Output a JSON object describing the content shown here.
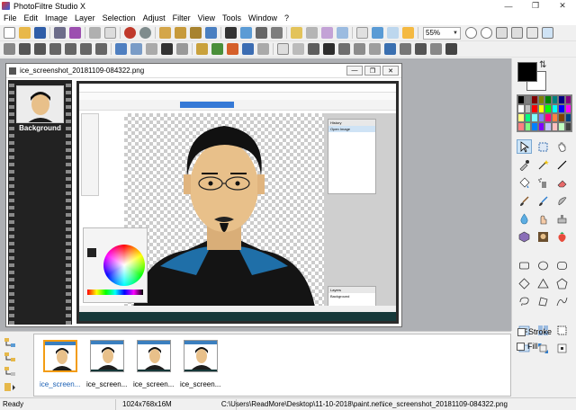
{
  "window": {
    "title": "PhotoFiltre Studio X"
  },
  "menu": [
    "File",
    "Edit",
    "Image",
    "Layer",
    "Selection",
    "Adjust",
    "Filter",
    "View",
    "Tools",
    "Window",
    "?"
  ],
  "toolbar": {
    "zoom_value": "55%"
  },
  "document": {
    "title": "ice_screenshot_20181109-084322.png",
    "layer_label": "Background",
    "inner_app": {
      "panel_layers_title": "Layers",
      "panel_history_title": "History",
      "history_item": "Open Image",
      "layer_item": "Background"
    }
  },
  "right_panel": {
    "fg_color": "#000000",
    "bg_color": "#ffffff",
    "stroke_label": "Stroke",
    "fill_label": "Fill",
    "palette": [
      "#000000",
      "#808080",
      "#800000",
      "#808000",
      "#008000",
      "#008080",
      "#000080",
      "#800080",
      "#ffffff",
      "#c0c0c0",
      "#ff0000",
      "#ffff00",
      "#00ff00",
      "#00ffff",
      "#0000ff",
      "#ff00ff",
      "#ffff80",
      "#00ff80",
      "#80ffff",
      "#8080ff",
      "#ff0080",
      "#ff8040",
      "#804000",
      "#004080",
      "#ff8080",
      "#80ff80",
      "#0080ff",
      "#8000ff",
      "#c0c0ff",
      "#ffc0c0",
      "#c0ffc0",
      "#404040"
    ]
  },
  "thumbnails": [
    {
      "label": "ice_screen...",
      "selected": true
    },
    {
      "label": "ice_screen...",
      "selected": false
    },
    {
      "label": "ice_screen...",
      "selected": false
    },
    {
      "label": "ice_screen...",
      "selected": false
    }
  ],
  "status": {
    "ready": "Ready",
    "size": "1024x768x16M",
    "path": "C:\\Users\\ReadMore\\Desktop\\11-10-2018\\paint.net\\ice_screenshot_20181109-084322.png"
  }
}
